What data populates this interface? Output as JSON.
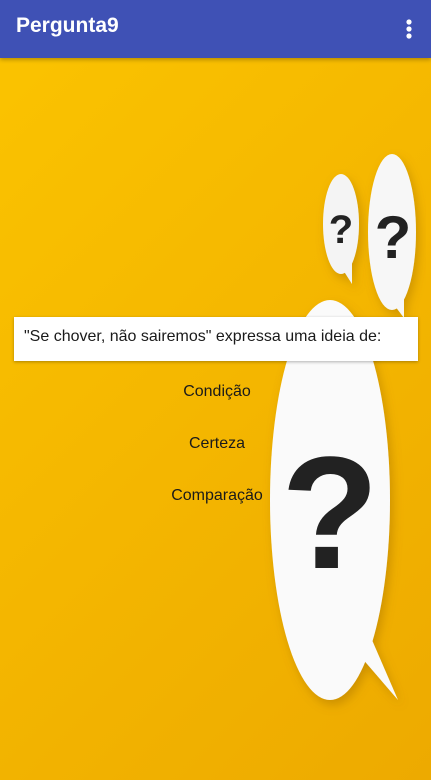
{
  "app_bar": {
    "title": "Pergunta9",
    "overflow_icon": "more-vert-icon"
  },
  "question": {
    "text": "\"Se chover, não sairemos\" expressa uma ideia de:"
  },
  "options": [
    {
      "label": "Condição"
    },
    {
      "label": "Certeza"
    },
    {
      "label": "Comparação"
    }
  ],
  "background": {
    "color": "#f5b800",
    "bubble_glyph": "?"
  },
  "colors": {
    "app_bar": "#3f51b5",
    "card": "#ffffff",
    "text": "#1a1a1a"
  }
}
